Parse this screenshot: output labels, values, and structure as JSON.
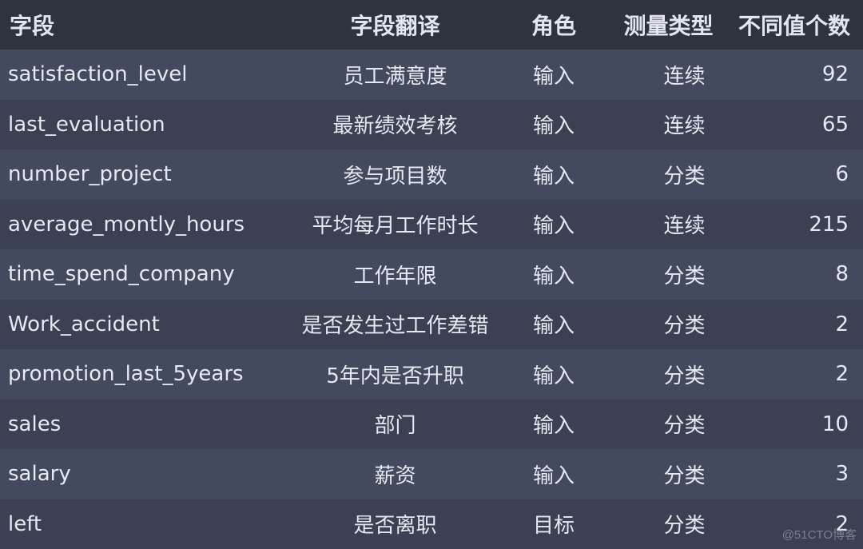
{
  "table": {
    "headers": {
      "field": "字段",
      "translation": "字段翻译",
      "role": "角色",
      "measure_type": "测量类型",
      "distinct_count": "不同值个数"
    },
    "rows": [
      {
        "field": "satisfaction_level",
        "translation": "员工满意度",
        "role": "输入",
        "measure_type": "连续",
        "distinct_count": "92"
      },
      {
        "field": "last_evaluation",
        "translation": "最新绩效考核",
        "role": "输入",
        "measure_type": "连续",
        "distinct_count": "65"
      },
      {
        "field": "number_project",
        "translation": "参与项目数",
        "role": "输入",
        "measure_type": "分类",
        "distinct_count": "6"
      },
      {
        "field": "average_montly_hours",
        "translation": "平均每月工作时长",
        "role": "输入",
        "measure_type": "连续",
        "distinct_count": "215"
      },
      {
        "field": "time_spend_company",
        "translation": "工作年限",
        "role": "输入",
        "measure_type": "分类",
        "distinct_count": "8"
      },
      {
        "field": "Work_accident",
        "translation": "是否发生过工作差错",
        "role": "输入",
        "measure_type": "分类",
        "distinct_count": "2"
      },
      {
        "field": "promotion_last_5years",
        "translation": "5年内是否升职",
        "role": "输入",
        "measure_type": "分类",
        "distinct_count": "2"
      },
      {
        "field": "sales",
        "translation": "部门",
        "role": "输入",
        "measure_type": "分类",
        "distinct_count": "10"
      },
      {
        "field": "salary",
        "translation": "薪资",
        "role": "输入",
        "measure_type": "分类",
        "distinct_count": "3"
      },
      {
        "field": "left",
        "translation": "是否离职",
        "role": "目标",
        "measure_type": "分类",
        "distinct_count": "2"
      }
    ]
  },
  "watermark": "@51CTO博客"
}
